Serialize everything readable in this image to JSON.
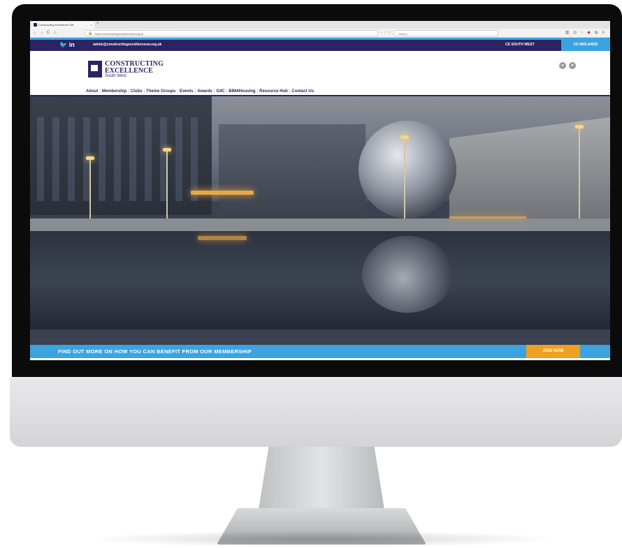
{
  "browser": {
    "tab_title": "Constructing Excellence SW",
    "tab_close": "×",
    "new_tab": "+",
    "back": "←",
    "forward": "→",
    "reload": "C",
    "home": "⌂",
    "url": "https://constructingexcellencesw.org.uk",
    "url_actions": "··· ♡ ☆",
    "search_placeholder": "Search"
  },
  "topbar": {
    "social": "🐦 in",
    "email": "admin@constructingexcellencesw.org.uk",
    "region_sw": "CE SOUTH WEST",
    "region_midlands": "CE MIDLANDS"
  },
  "logo": {
    "line1": "CONSTRUCTING",
    "line2": "EXCELLENCE",
    "line3": "South West"
  },
  "nav": {
    "items": [
      "About",
      "Membership",
      "Clubs",
      "Theme Groups",
      "Events",
      "Awards",
      "G4C",
      "BIM4Housing",
      "Resource Hub",
      "Contact Us"
    ],
    "separator": "|"
  },
  "header_icons": {
    "user": "●",
    "cart": "●"
  },
  "cta": {
    "text": "FIND OUT MORE ON HOW YOU CAN BENEFIT FROM OUR MEMBERSHIP",
    "button": "JOIN NOW"
  },
  "colors": {
    "brand_navy": "#2b2462",
    "brand_blue": "#3ba3e0",
    "join_orange": "#f0a020"
  }
}
